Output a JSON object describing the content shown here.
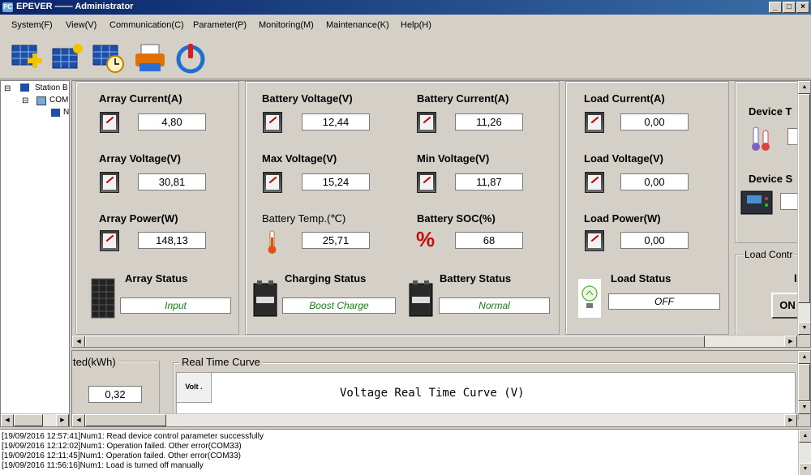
{
  "window": {
    "title": "EPEVER —— Administrator",
    "app_icon_label": "PC"
  },
  "menu": [
    "System(F)",
    "View(V)",
    "Communication(C)",
    "Parameter(P)",
    "Monitoring(M)",
    "Maintenance(K)",
    "Help(H)"
  ],
  "tree": {
    "root": "Station B",
    "child": "COM",
    "leaf": "N"
  },
  "array": {
    "current_label": "Array Current(A)",
    "current_value": "4,80",
    "voltage_label": "Array Voltage(V)",
    "voltage_value": "30,81",
    "power_label": "Array Power(W)",
    "power_value": "148,13",
    "status_label": "Array Status",
    "status_value": "Input"
  },
  "battery": {
    "voltage_label": "Battery Voltage(V)",
    "voltage_value": "12,44",
    "current_label": "Battery Current(A)",
    "current_value": "11,26",
    "max_voltage_label": "Max Voltage(V)",
    "max_voltage_value": "15,24",
    "min_voltage_label": "Min Voltage(V)",
    "min_voltage_value": "11,87",
    "temp_label": "Battery Temp.(℃)",
    "temp_value": "25,71",
    "soc_label": "Battery SOC(%)",
    "soc_value": "68",
    "charging_status_label": "Charging Status",
    "charging_status_value": "Boost Charge",
    "status_label": "Battery Status",
    "status_value": "Normal"
  },
  "load": {
    "current_label": "Load Current(A)",
    "current_value": "0,00",
    "voltage_label": "Load Voltage(V)",
    "voltage_value": "0,00",
    "power_label": "Load Power(W)",
    "power_value": "0,00",
    "status_label": "Load Status",
    "status_value": "OFF"
  },
  "device": {
    "temp_label_partial": "Device T",
    "status_label_partial": "Device S",
    "load_control_label": "Load Contr",
    "load_control_partial": "l",
    "on_button_partial": "ON"
  },
  "energy": {
    "label_partial": "ted(kWh)",
    "value": "0,32"
  },
  "curve": {
    "group_label": "Real Time Curve",
    "tab_label": "Volt .",
    "title": "Voltage Real Time Curve (V)"
  },
  "log": [
    "[19/09/2016 12:57:41]Num1: Read device control parameter successfully",
    "[19/09/2016 12:12:02]Num1: Operation failed. Other error(COM33)",
    "[19/09/2016 12:11:45]Num1: Operation failed. Other error(COM33)",
    "[19/09/2016 11:56:16]Num1: Load is turned off manually"
  ],
  "colors": {
    "titlebar": "#0a246a",
    "status_text": "#1a7a1a",
    "window_bg": "#d4d0c8"
  }
}
